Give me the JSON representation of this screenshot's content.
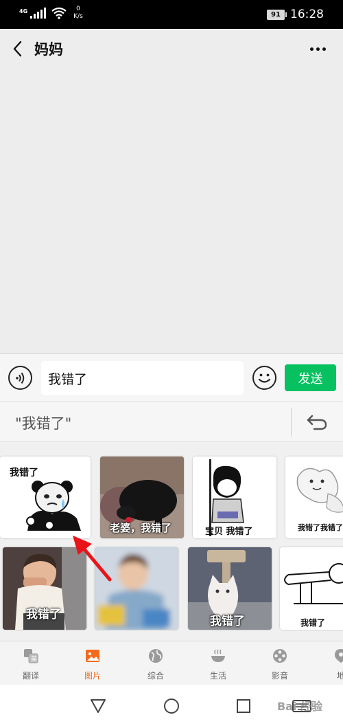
{
  "status_bar": {
    "network": "4G",
    "speed_value": "0",
    "speed_unit": "K/s",
    "battery": "91",
    "time": "16:28"
  },
  "header": {
    "title": "妈妈",
    "back_icon": "chevron-left-icon",
    "more_icon": "more-dots-icon"
  },
  "input_bar": {
    "message": "我错了",
    "send_label": "发送"
  },
  "suggestion": {
    "text": "\"我错了\""
  },
  "stickers": [
    {
      "caption": "我错了"
    },
    {
      "caption": "老婆，我错了"
    },
    {
      "caption": "宝贝 我错了"
    },
    {
      "caption": "我错了我错了"
    },
    {
      "caption": "我错了"
    },
    {
      "caption": ""
    },
    {
      "caption": "我错了"
    },
    {
      "caption": "我错了"
    }
  ],
  "tabs": [
    {
      "label": "翻译",
      "icon": "translate-icon",
      "active": false
    },
    {
      "label": "图片",
      "icon": "image-icon",
      "active": true
    },
    {
      "label": "综合",
      "icon": "globe-icon",
      "active": false
    },
    {
      "label": "生活",
      "icon": "bowl-icon",
      "active": false
    },
    {
      "label": "影音",
      "icon": "film-reel-icon",
      "active": false
    },
    {
      "label": "地",
      "icon": "map-pin-icon",
      "active": false
    }
  ],
  "watermark": "Bai 经验",
  "colors": {
    "send_button": "#07c160",
    "active_tab": "#f26b1d",
    "arrow": "#e8141a"
  }
}
